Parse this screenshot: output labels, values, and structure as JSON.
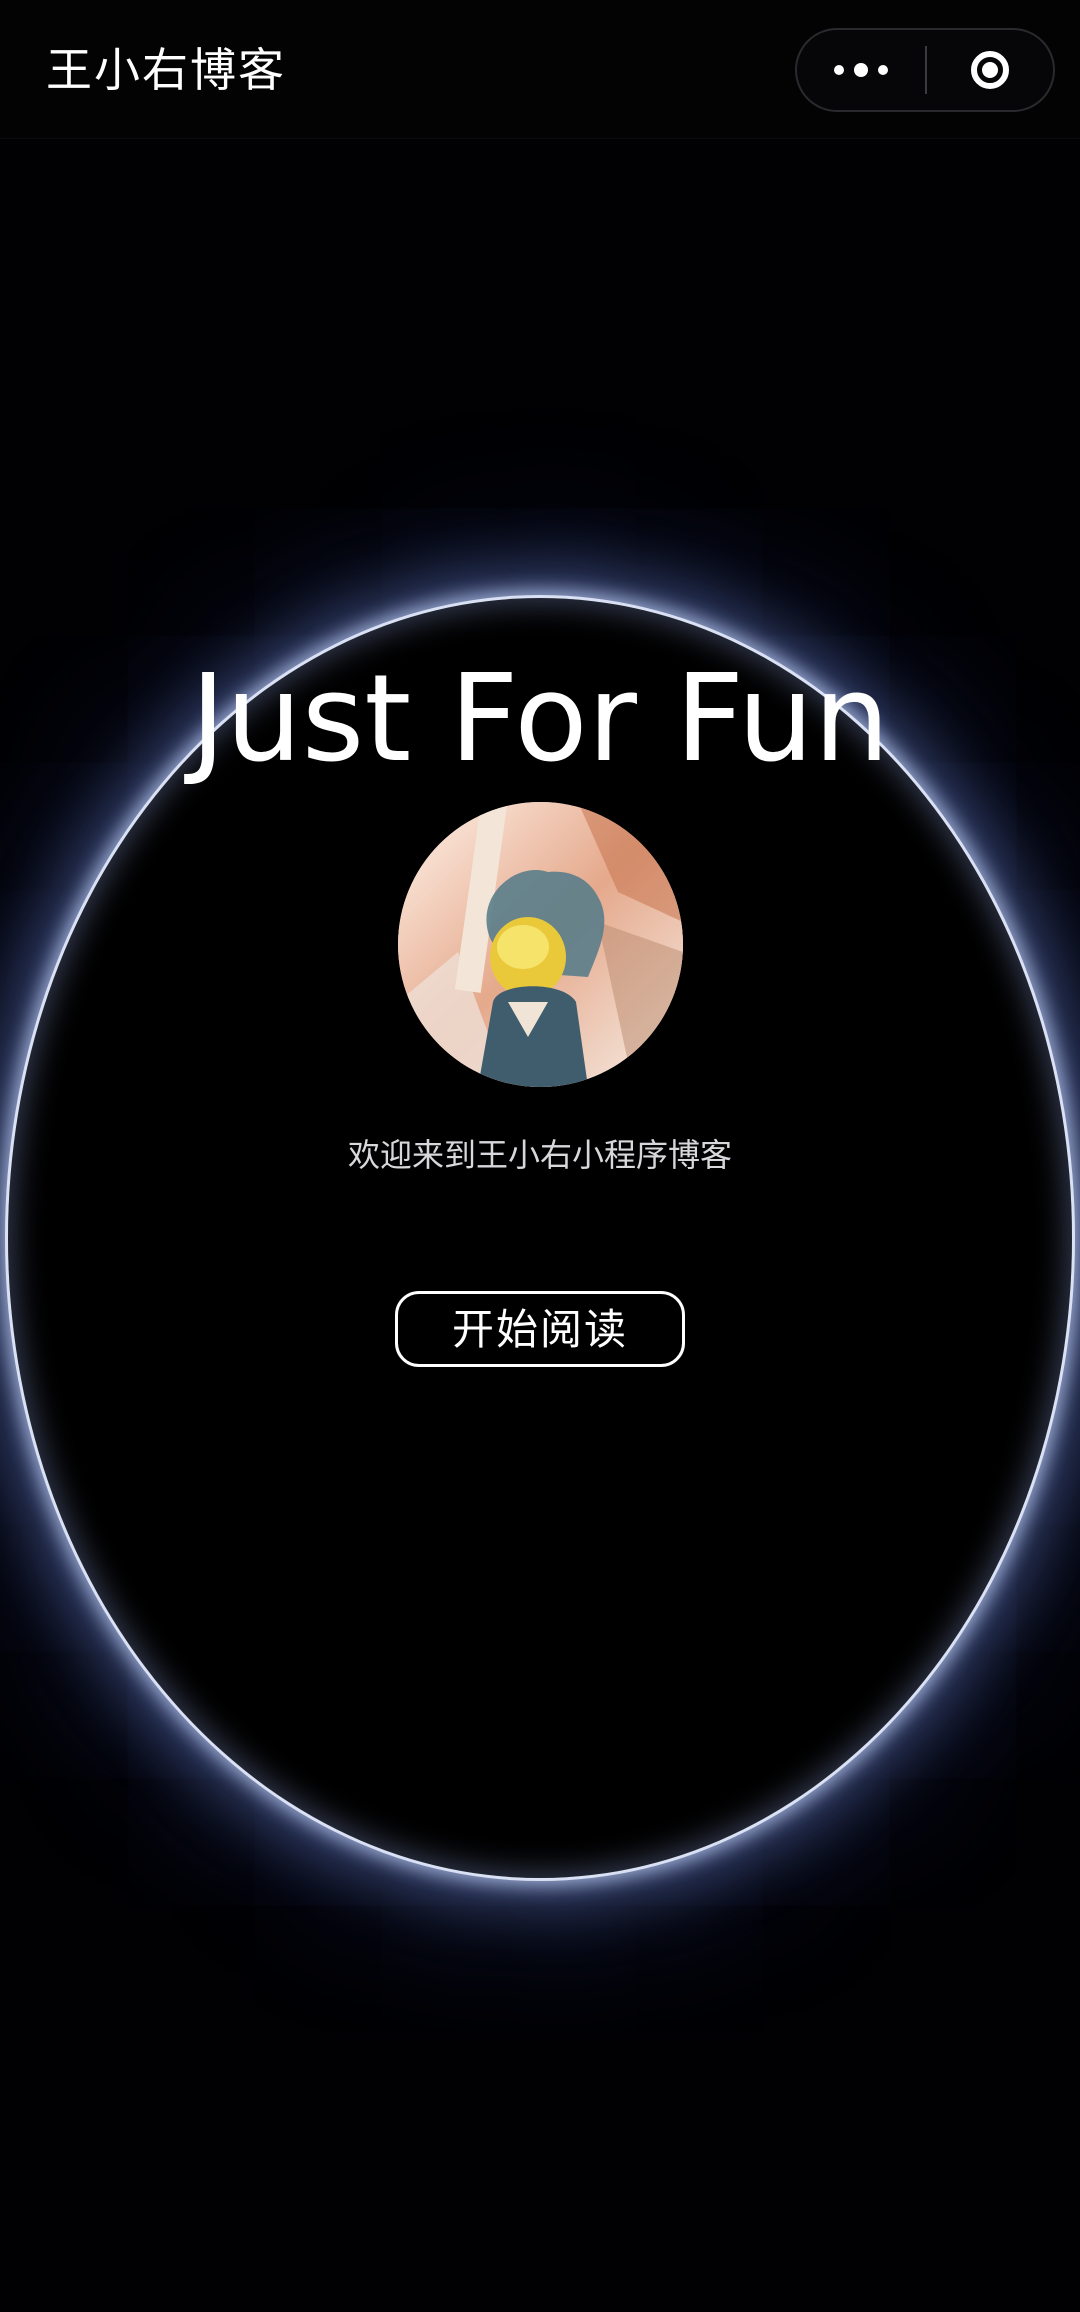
{
  "navbar": {
    "title": "王小右博客",
    "more_icon": "more-dots-icon",
    "close_icon": "target-circle-icon"
  },
  "hero": {
    "headline": "Just For Fun",
    "welcome_text": "欢迎来到王小右小程序博客",
    "read_button_label": "开始阅读"
  },
  "colors": {
    "background": "#010104",
    "ring_glow": "#aebfff",
    "text": "#ffffff"
  }
}
